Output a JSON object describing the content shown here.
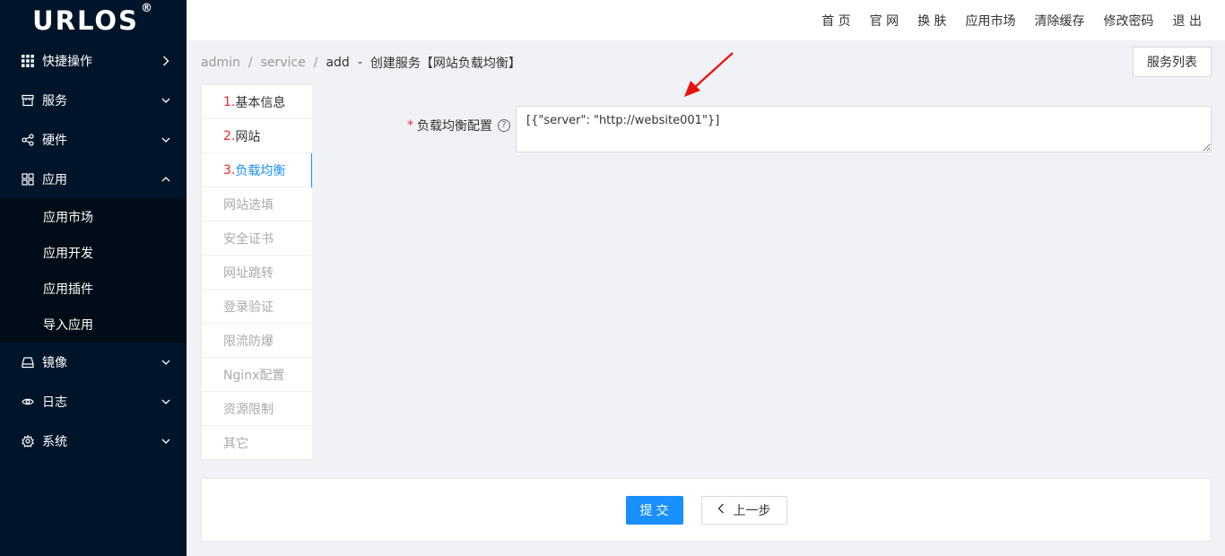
{
  "app": {
    "logo": "URLOS",
    "logo_mark": "®"
  },
  "header": {
    "links": [
      "首 页",
      "官 网",
      "换 肤",
      "应用市场",
      "清除缓存",
      "修改密码",
      "退 出"
    ]
  },
  "sidebar": {
    "items": [
      {
        "label": "快捷操作",
        "icon": "grid-icon",
        "arrow": "right"
      },
      {
        "label": "服务",
        "icon": "shop-icon",
        "arrow": "down"
      },
      {
        "label": "硬件",
        "icon": "share-icon",
        "arrow": "down"
      },
      {
        "label": "应用",
        "icon": "apps-icon",
        "arrow": "up"
      }
    ],
    "submenu": [
      "应用市场",
      "应用开发",
      "应用插件",
      "导入应用"
    ],
    "items_after": [
      {
        "label": "镜像",
        "icon": "drive-icon",
        "arrow": "down"
      },
      {
        "label": "日志",
        "icon": "eye-icon",
        "arrow": "down"
      },
      {
        "label": "系统",
        "icon": "gear-icon",
        "arrow": "down"
      }
    ]
  },
  "breadcrumb": {
    "crumbs": [
      "admin",
      "service",
      "add"
    ],
    "dash": "-",
    "title": "创建服务【网站负载均衡】"
  },
  "service_list_button": "服务列表",
  "steps": [
    {
      "num": "1.",
      "label": "基本信息",
      "state": "done"
    },
    {
      "num": "2.",
      "label": "网站",
      "state": "done"
    },
    {
      "num": "3.",
      "label": "负载均衡",
      "state": "active"
    },
    {
      "num": "",
      "label": "网站选填",
      "state": "pending"
    },
    {
      "num": "",
      "label": "安全证书",
      "state": "pending"
    },
    {
      "num": "",
      "label": "网址跳转",
      "state": "pending"
    },
    {
      "num": "",
      "label": "登录验证",
      "state": "pending"
    },
    {
      "num": "",
      "label": "限流防爆",
      "state": "pending"
    },
    {
      "num": "",
      "label": "Nginx配置",
      "state": "pending"
    },
    {
      "num": "",
      "label": "资源限制",
      "state": "pending"
    },
    {
      "num": "",
      "label": "其它",
      "state": "pending"
    }
  ],
  "form": {
    "required_mark": "*",
    "label": "负载均衡配置",
    "help": "?",
    "value": "[{\"server\": \"http://website001\"}]"
  },
  "footer": {
    "submit": "提交",
    "prev": "上一步",
    "prev_icon": "<"
  },
  "colors": {
    "primary": "#1890ff",
    "sidebar": "#001529",
    "annotation": "#e8120c"
  }
}
